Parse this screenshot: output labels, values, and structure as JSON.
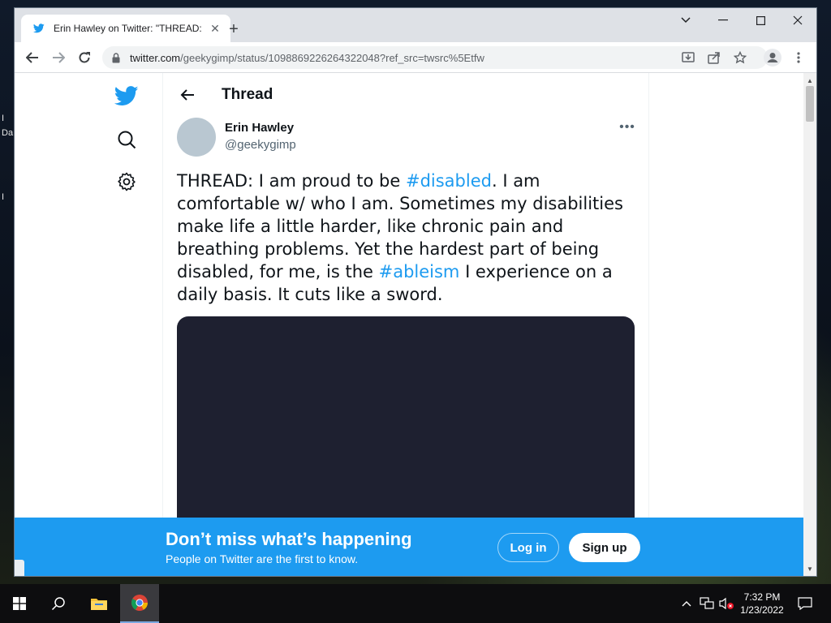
{
  "desktop": {
    "fragments": [
      "I",
      "Da",
      "I"
    ]
  },
  "browser": {
    "tab": {
      "title": "Erin Hawley on Twitter: \"THREAD: ...",
      "favicon": "twitter-bird-icon"
    },
    "address": {
      "host": "twitter.com",
      "path": "/geekygimp/status/1098869226264322048?ref_src=twsrc%5Etfw"
    },
    "icons": [
      "back-icon",
      "forward-icon",
      "reload-icon",
      "install-icon",
      "share-icon",
      "star-icon",
      "profile-icon",
      "menu-icon"
    ]
  },
  "twitter": {
    "thread_title": "Thread",
    "author": {
      "name": "Erin Hawley",
      "handle": "@geekygimp"
    },
    "tweet": {
      "part1": "THREAD: I am proud to be ",
      "tag1": "#disabled",
      "part2": ". I am comfortable w/ who I am. Sometimes my disabilities make life a little harder, like chronic pain and breathing problems. Yet the hardest part of being disabled, for me, is the ",
      "tag2": "#ableism",
      "part3": " I experience on a daily basis. It cuts like a sword."
    },
    "banner": {
      "title": "Don’t miss what’s happening",
      "subtitle": "People on Twitter are the first to know.",
      "login_label": "Log in",
      "signup_label": "Sign up"
    },
    "colors": {
      "brand": "#1d9bf0",
      "media_bg": "#1e2030"
    }
  },
  "taskbar": {
    "time": "7:32 PM",
    "date": "1/23/2022"
  }
}
